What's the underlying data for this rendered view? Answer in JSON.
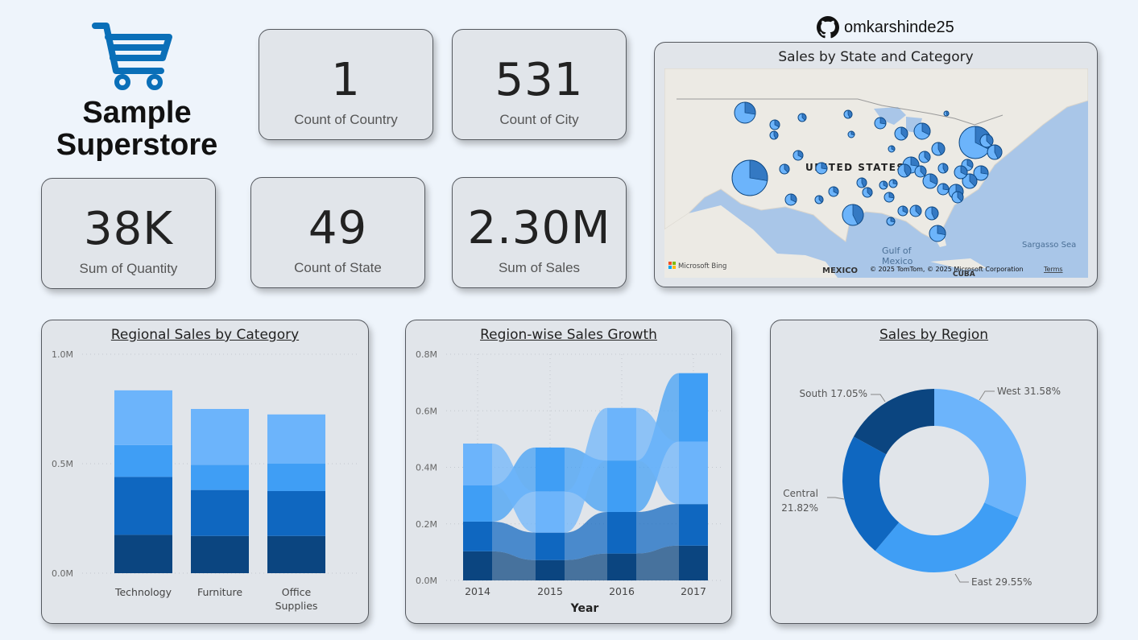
{
  "logo": {
    "line1": "Sample",
    "line2": "Superstore",
    "icon": "shopping-cart-icon",
    "icon_color": "#0a6fb8"
  },
  "github": {
    "icon": "github-icon",
    "handle": "omkarshinde25"
  },
  "kpis": [
    {
      "value": "1",
      "label": "Count of Country"
    },
    {
      "value": "531",
      "label": "Count of City"
    },
    {
      "value": "38K",
      "label": "Sum of Quantity"
    },
    {
      "value": "49",
      "label": "Count of State"
    },
    {
      "value": "2.30M",
      "label": "Sum of Sales"
    }
  ],
  "map": {
    "title": "Sales by State and Category",
    "country_label": "UNITED STATES",
    "gulf_label_1": "Gulf of",
    "gulf_label_2": "Mexico",
    "sea_label": "Sargasso Sea",
    "mexico_label": "MEXICO",
    "cuba_label": "CUBA",
    "bing_label": "Microsoft Bing",
    "copyright": "© 2025 TomTom, © 2025 Microsoft Corporation",
    "terms": "Terms"
  },
  "colors": {
    "c1": "#6cb4fb",
    "c2": "#3f9ef5",
    "c3": "#0f67c0",
    "c4": "#0b4580"
  },
  "chart_data": [
    {
      "type": "bar",
      "title": "Regional Sales by Category",
      "categories": [
        "Technology",
        "Furniture",
        "Office Supplies"
      ],
      "category_lines": [
        [
          "Technology"
        ],
        [
          "Furniture"
        ],
        [
          "Office",
          "Supplies"
        ]
      ],
      "ylim": [
        0,
        1000000
      ],
      "ytick_labels": [
        "0.0M",
        "0.5M",
        "1.0M"
      ],
      "ytick_values": [
        0,
        500000,
        1000000
      ],
      "series": [
        {
          "values": [
            175000,
            170000,
            170000
          ]
        },
        {
          "values": [
            265000,
            210000,
            205000
          ]
        },
        {
          "values": [
            145000,
            115000,
            125000
          ]
        },
        {
          "values": [
            250000,
            255000,
            225000
          ]
        }
      ]
    },
    {
      "type": "area",
      "title": "Region-wise Sales Growth",
      "xlabel": "Year",
      "categories": [
        "2014",
        "2015",
        "2016",
        "2017"
      ],
      "ylim": [
        0,
        800000
      ],
      "ytick_labels": [
        "0.0M",
        "0.2M",
        "0.4M",
        "0.6M",
        "0.8M"
      ],
      "ytick_values": [
        0,
        200000,
        400000,
        600000,
        800000
      ],
      "series": [
        {
          "values": [
            103000,
            72000,
            95000,
            123000
          ]
        },
        {
          "values": [
            105000,
            97000,
            147000,
            147000
          ]
        },
        {
          "values": [
            128000,
            156000,
            182000,
            242000
          ]
        },
        {
          "values": [
            148000,
            145000,
            186000,
            221000
          ]
        }
      ]
    },
    {
      "type": "pie",
      "title": "Sales by Region",
      "categories": [
        "West",
        "East",
        "Central",
        "South"
      ],
      "values": [
        31.58,
        29.55,
        21.82,
        17.05
      ],
      "labels": [
        "West 31.58%",
        "East 29.55%",
        "Central",
        "South 17.05%"
      ],
      "central_pct": "21.82%"
    }
  ]
}
